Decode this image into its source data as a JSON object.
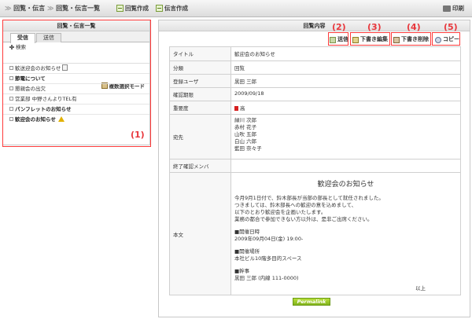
{
  "breadcrumb": [
    "回覧・伝言",
    "回覧・伝言一覧"
  ],
  "toolbar": {
    "circular_create": "回覧作成",
    "message_create": "伝言作成",
    "print": "印刷"
  },
  "list_panel": {
    "title": "回覧・伝言一覧",
    "tabs": [
      "受信",
      "送信"
    ],
    "search": "検索",
    "multi_select_mode": "複数選択モード",
    "items": [
      {
        "label": "歓送迎会のお知らせ",
        "bold": false,
        "icon": "document-icon"
      },
      {
        "label": "節電について",
        "bold": true,
        "icon": ""
      },
      {
        "label": "懇親会の出欠",
        "bold": false,
        "icon": ""
      },
      {
        "label": "営業部 中野さんよりTEL有",
        "bold": false,
        "icon": ""
      },
      {
        "label": "パンフレットのお知らせ",
        "bold": true,
        "icon": ""
      },
      {
        "label": "歓迎会のお知らせ",
        "bold": true,
        "icon": "warning-icon"
      }
    ]
  },
  "annotations": [
    "(1)",
    "(2)",
    "(3)",
    "(4)",
    "(5)"
  ],
  "detail_panel": {
    "title": "回覧内容",
    "actions": {
      "send": "送信",
      "draft_edit": "下書き編集",
      "draft_delete": "下書き削除",
      "copy": "コピー"
    },
    "rows": {
      "title_label": "タイトル",
      "title_value": "歓迎会のお知らせ",
      "category_label": "分類",
      "category_value": "回覧",
      "user_label": "登録ユーザ",
      "user_value": "黒田 三郎",
      "deadline_label": "確認期限",
      "deadline_value": "2009/09/18",
      "importance_label": "重要度",
      "importance_value": "高",
      "recipients_label": "宛先",
      "recipients": [
        "緑川 次郎",
        "赤村 花子",
        "山吹 五郎",
        "白山 六郎",
        "藍田 奈々子"
      ],
      "finished_label": "終了確認メンバ",
      "body_label": "本文"
    },
    "body": {
      "heading": "歓迎会のお知らせ",
      "lines": [
        "今月9月1日付で、鈴木部長が当部の部長として就任されました。",
        "つきましては、鈴木部長への歓迎の意を込めまして、",
        "以下のとおり歓迎会を企画いたします。",
        "業務の都合で参加できない方以外は、是非ご出席ください。"
      ],
      "date_label": "■開催日時",
      "date_value": "2009年09月04日(金) 19:00-",
      "place_label": "■開催場所",
      "place_value": "本社ビル10階多目的スペース",
      "admin_label": "■幹事",
      "admin_value": "黒田 三郎 (内線 111-0000)",
      "closing": "以上"
    },
    "permalink": "Permalink"
  }
}
